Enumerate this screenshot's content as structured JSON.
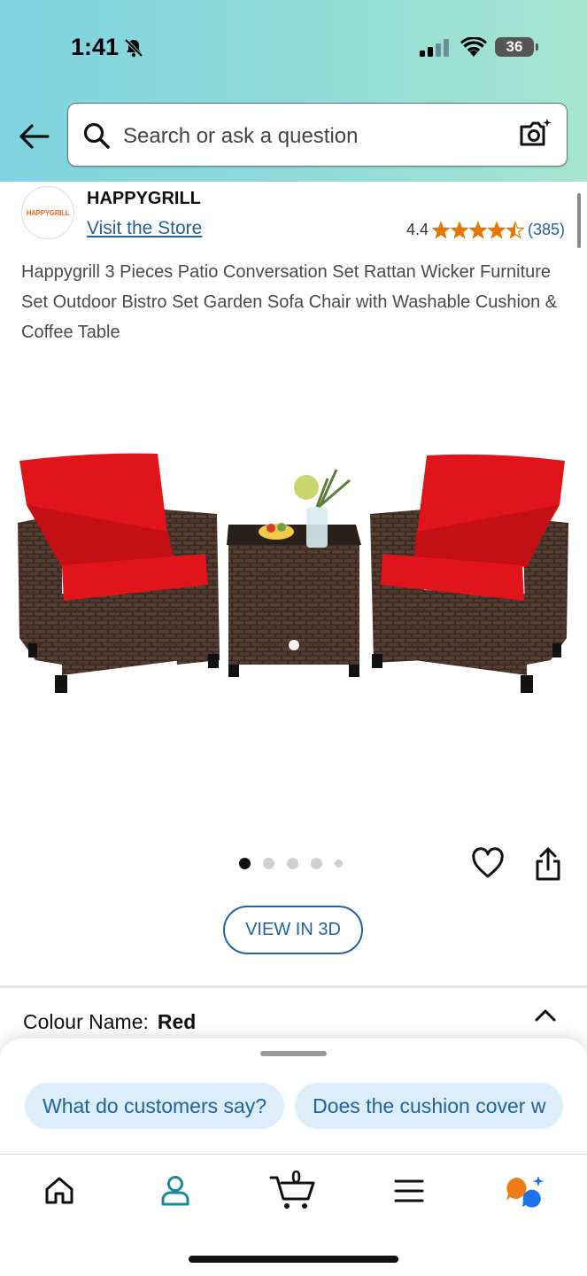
{
  "status_bar": {
    "time": "1:41",
    "battery": "36"
  },
  "search": {
    "placeholder": "Search or ask a question"
  },
  "brand": {
    "logo_text": "HAPPYGRILL",
    "name": "HAPPYGRILL",
    "visit_store": "Visit the Store"
  },
  "rating": {
    "value": "4.4",
    "stars": 4.5,
    "count": "(385)",
    "star_color": "#e77600"
  },
  "product": {
    "title": "Happygrill 3 Pieces Patio Conversation Set Rattan Wicker Furniture Set Outdoor Bistro Set Garden Sofa Chair with Washable Cushion & Coffee Table",
    "image_count": 5,
    "active_image": 1
  },
  "actions": {
    "view_3d": "VIEW IN 3D"
  },
  "variation": {
    "label": "Colour Name:",
    "value": "Red"
  },
  "suggestions": [
    "What do customers say?",
    "Does the cushion cover w"
  ],
  "nav": {
    "cart_count": "0",
    "items": [
      "home-icon",
      "account-icon",
      "cart-icon",
      "menu-icon",
      "rufus-icon"
    ]
  },
  "colors": {
    "link": "#2162a1",
    "chip_bg": "#dceef9",
    "header_gradient": [
      "#7fd3e0",
      "#a6e6d0"
    ]
  }
}
